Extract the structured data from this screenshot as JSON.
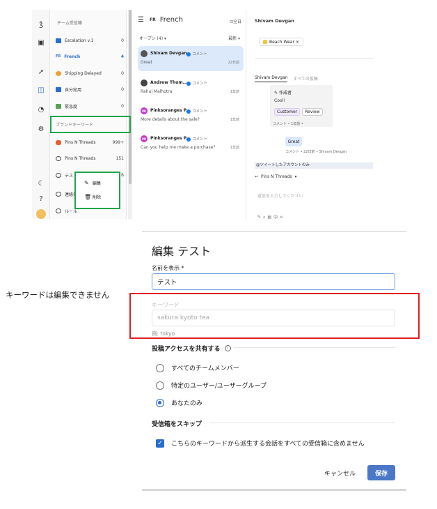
{
  "app": {
    "sidebar": {
      "heading": "チーム受信箱",
      "items": [
        {
          "label": "Escalation v.1",
          "count": "0",
          "color": "#2b6ccf"
        },
        {
          "label": "French",
          "count": "4",
          "tag": "FR",
          "active": true
        },
        {
          "label": "Shipping Delayed",
          "count": "0",
          "color": "#f0a030"
        },
        {
          "label": "自分宛用",
          "count": "0",
          "color": "#2b6ccf"
        },
        {
          "label": "緊急度",
          "count": "0",
          "color": "#5aa05a"
        },
        {
          "label": "ブランドキーワード",
          "count": ""
        },
        {
          "label": "Pins N Threads",
          "count": "999+",
          "color": "#e85c2c"
        },
        {
          "label": "Pins N Threads",
          "count": "151",
          "color": "#444444"
        },
        {
          "label": "テスト",
          "count": "6",
          "color": "#444444"
        },
        {
          "label": "連絡先",
          "count": "",
          "color": "#444444"
        },
        {
          "label": "ルール",
          "count": "",
          "color": "#444444"
        }
      ]
    },
    "context_menu": {
      "edit": "編集",
      "delete": "削除"
    },
    "conversations": {
      "lang_tag": "FR",
      "title": "French",
      "all_label": "⊡全日",
      "open_label": "オープン (4) ▾",
      "sort_label": "最新 ▾",
      "items": [
        {
          "name": "Shivam Devgan",
          "type": "コメント",
          "msg": "Great",
          "time": "22日前",
          "selected": true,
          "avatar_color": "#555555"
        },
        {
          "name": "Andrew Thom...",
          "type": "コメント",
          "msg": "Rahul Malhotra",
          "time": "1年前",
          "avatar_color": "#444444"
        },
        {
          "name": "Pinksoranges P...",
          "type": "コメント",
          "msg": "More details about the sale?",
          "time": "1年前",
          "avatar_color": "#c43bc9",
          "initials": "PP"
        },
        {
          "name": "Pinksoranges P...",
          "type": "コメント",
          "msg": "Can you help me make a purchase?",
          "time": "1年前",
          "avatar_color": "#c43bc9",
          "initials": "PP"
        }
      ]
    },
    "detail": {
      "name": "Shivam Devgan",
      "tag": "Beach Wear",
      "tab_active": "Shivam Devgan",
      "tab_other": "すべての投稿",
      "note_title": "作成者",
      "note_body": "Cool!",
      "chips": [
        "Customer",
        "Review"
      ],
      "note_meta": "コメント • 1年前 •",
      "reply": "Great",
      "reply_meta": "コメント • 22日前 • Shivam Devgan",
      "tweet_label": "@ツイートしたアカウントのみ",
      "reply_to": "Pins N Threads",
      "reply_placeholder": "返信を入力してください"
    }
  },
  "annotation": {
    "text": "キーワードは編集できません"
  },
  "dialog": {
    "title": "編集 テスト",
    "name_label": "名前を表示 *",
    "name_value": "テスト",
    "keyword_label": "キーワード",
    "keyword_value": "sakura kyoto tea",
    "keyword_hint": "例: tokyo",
    "share_heading": "投稿アクセスを共有する",
    "options": [
      "すべてのチームメンバー",
      "特定のユーザー/ユーザーグループ",
      "あなたのみ"
    ],
    "selected_option": 2,
    "skip_heading": "受信箱をスキップ",
    "skip_label": "こちらのキーワードから派生する会話をすべての受信箱に含めません",
    "cancel": "キャンセル",
    "save": "保存"
  },
  "colors": {
    "accent": "#2b6ccf",
    "highlight_green": "#1fa64a",
    "highlight_red": "#e01e1e"
  }
}
